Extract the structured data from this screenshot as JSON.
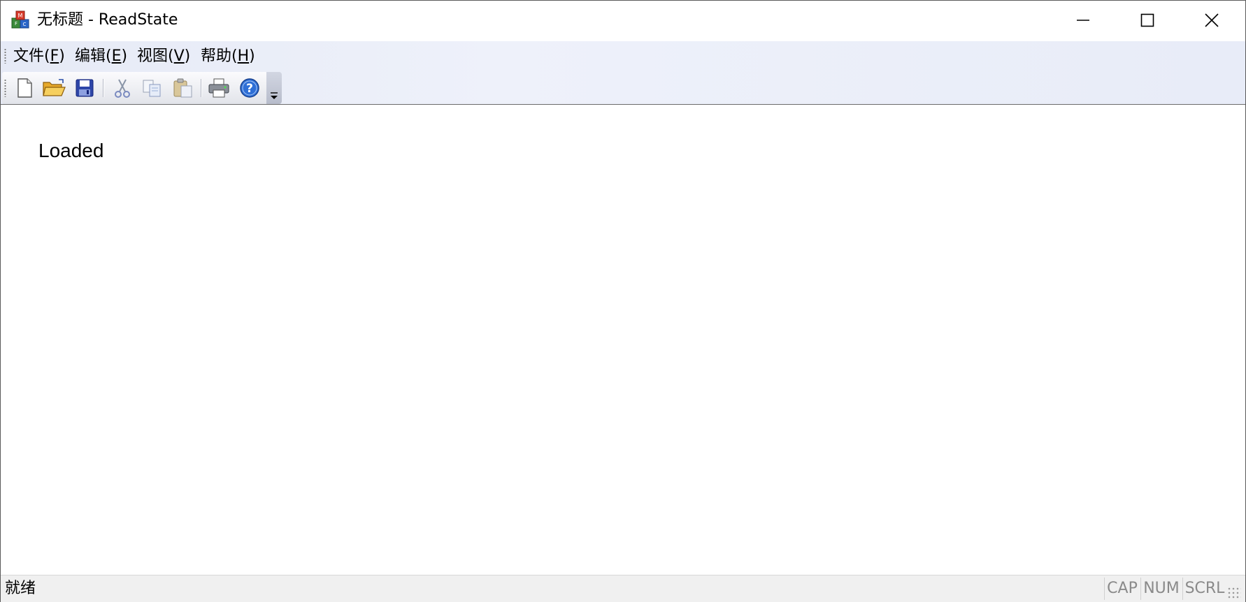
{
  "window": {
    "title": "无标题 - ReadState",
    "app_icon": "mfc-app-icon",
    "controls": [
      "minimize-icon",
      "maximize-icon",
      "close-icon"
    ]
  },
  "menubar": {
    "items": [
      {
        "label": "文件",
        "mnemonic": "F"
      },
      {
        "label": "编辑",
        "mnemonic": "E"
      },
      {
        "label": "视图",
        "mnemonic": "V"
      },
      {
        "label": "帮助",
        "mnemonic": "H"
      }
    ]
  },
  "toolbar": {
    "buttons": [
      "new-document-icon",
      "open-folder-icon",
      "save-icon",
      "cut-icon",
      "copy-icon",
      "paste-icon",
      "print-icon",
      "help-icon"
    ],
    "overflow": "toolbar-overflow-icon"
  },
  "document": {
    "text": "Loaded"
  },
  "statusbar": {
    "status": "就绪",
    "indicators": [
      "CAP",
      "NUM",
      "SCRL"
    ]
  }
}
